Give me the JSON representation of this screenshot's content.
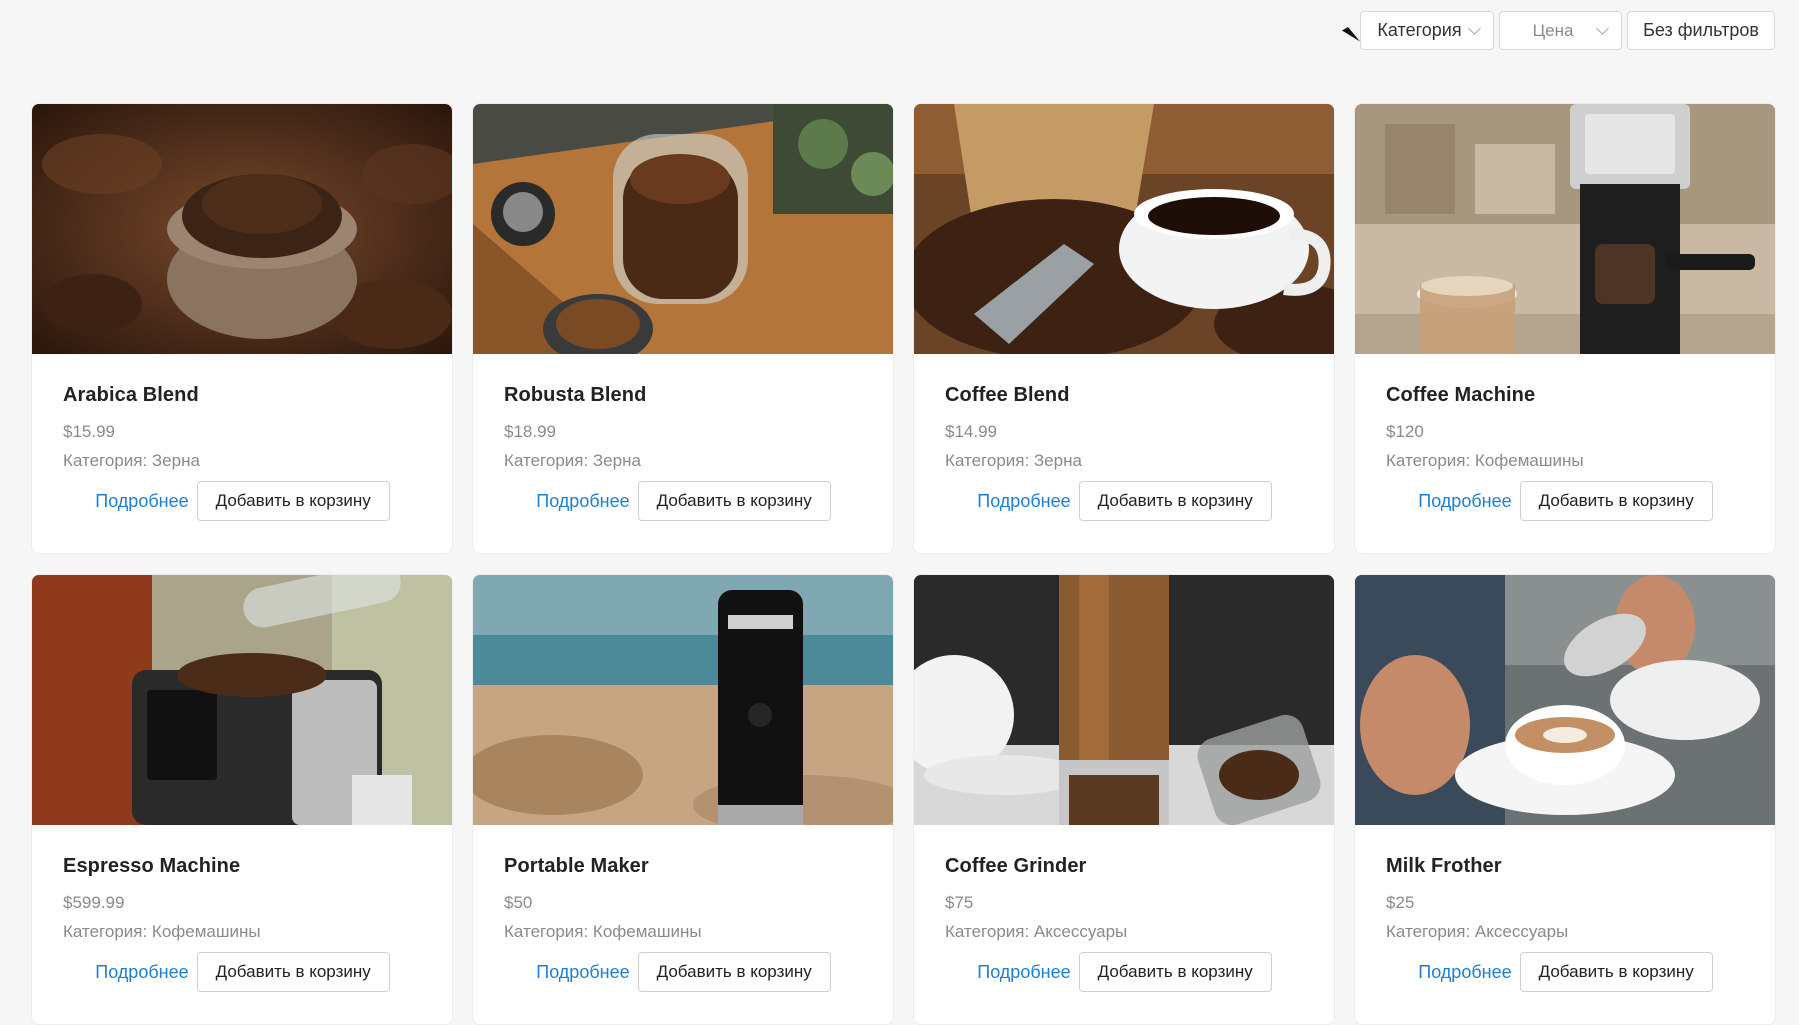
{
  "toolbar": {
    "category_label": "Категория",
    "price_label": "Цена",
    "clear_label": "Без фильтров"
  },
  "details_label": "Подробнее",
  "add_to_cart_label": "Добавить в корзину",
  "products": [
    {
      "name": "Arabica Blend",
      "price": "$15.99",
      "category": "Категория: Зерна"
    },
    {
      "name": "Robusta Blend",
      "price": "$18.99",
      "category": "Категория: Зерна"
    },
    {
      "name": "Coffee Blend",
      "price": "$14.99",
      "category": "Категория: Зерна"
    },
    {
      "name": "Coffee Machine",
      "price": "$120",
      "category": "Категория: Кофемашины"
    },
    {
      "name": "Espresso Machine",
      "price": "$599.99",
      "category": "Категория: Кофемашины"
    },
    {
      "name": "Portable Maker",
      "price": "$50",
      "category": "Категория: Кофемашины"
    },
    {
      "name": "Coffee Grinder",
      "price": "$75",
      "category": "Категория: Аксессуары"
    },
    {
      "name": "Milk Frother",
      "price": "$25",
      "category": "Категория: Аксессуары"
    }
  ],
  "colors": {
    "link": "#1b7fd6",
    "background": "#f5f6f5"
  }
}
